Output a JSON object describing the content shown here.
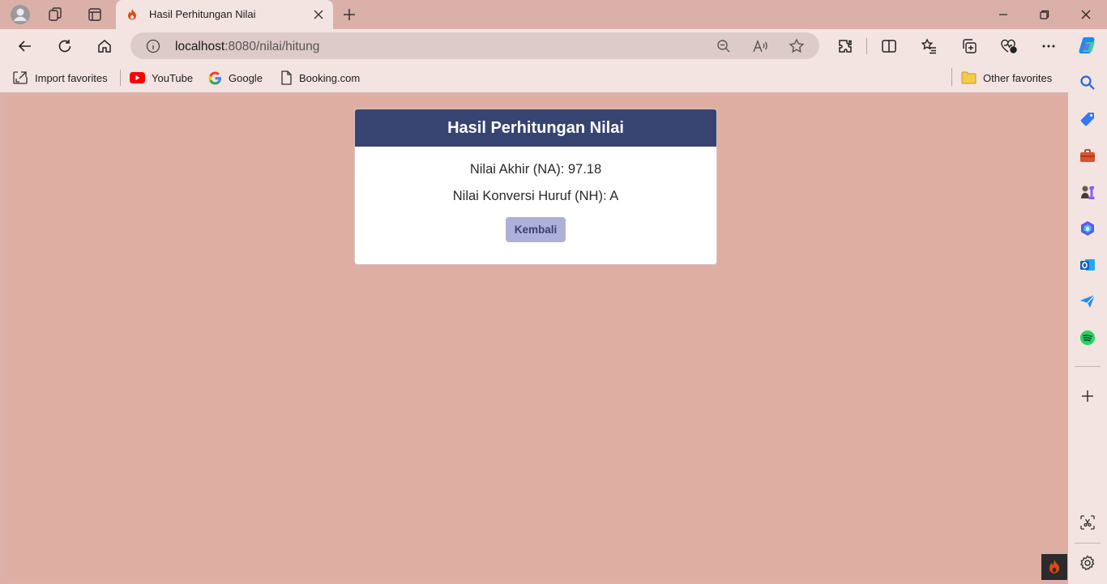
{
  "browser": {
    "tab_title": "Hasil Perhitungan Nilai",
    "url_host": "localhost",
    "url_rest": ":8080/nilai/hitung"
  },
  "favorites": [
    {
      "label": "Import favorites",
      "icon": "import-icon"
    },
    {
      "label": "YouTube",
      "icon": "youtube-icon"
    },
    {
      "label": "Google",
      "icon": "google-icon"
    },
    {
      "label": "Booking.com",
      "icon": "page-icon"
    },
    {
      "label": "Other favorites",
      "icon": "folder-icon"
    }
  ],
  "card": {
    "title": "Hasil Perhitungan Nilai",
    "na_line": "Nilai Akhir (NA): 97.18",
    "nh_line": "Nilai Konversi Huruf (NH): A",
    "back_button": "Kembali"
  },
  "colors": {
    "page_background": "#dfaea2",
    "card_header": "#374471",
    "button": "#adb0db",
    "browser_frame": "#dbb0a8"
  }
}
